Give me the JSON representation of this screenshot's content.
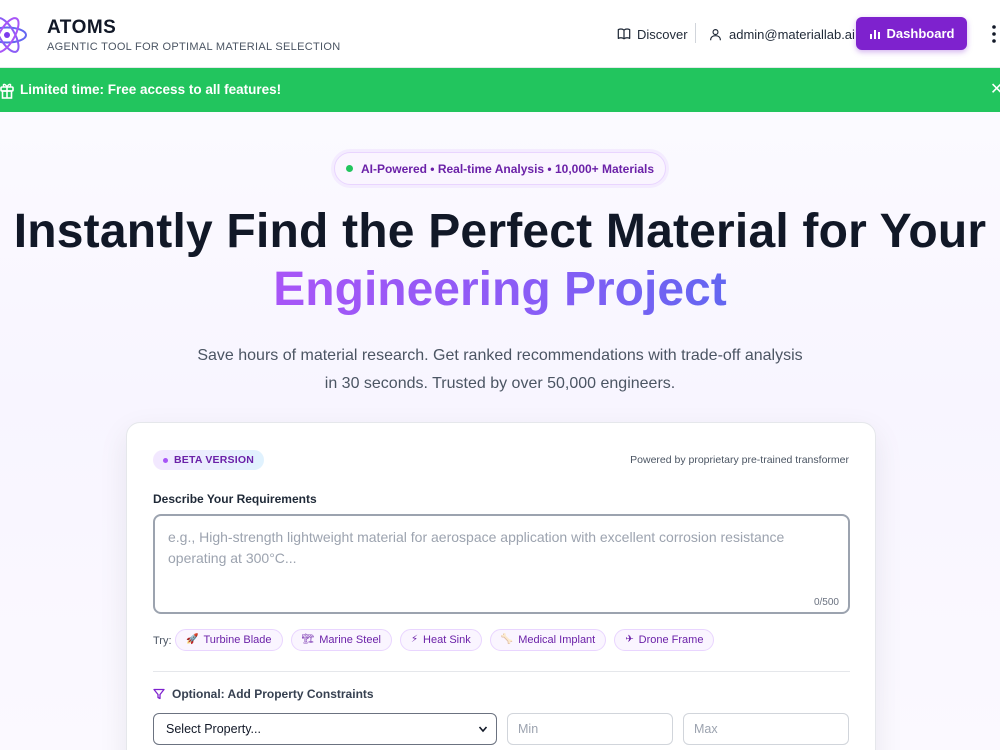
{
  "header": {
    "brand_name": "ATOMS",
    "brand_tagline": "AGENTIC TOOL FOR OPTIMAL MATERIAL SELECTION",
    "discover_label": "Discover",
    "user_email": "admin@materiallab.ai",
    "dashboard_label": "Dashboard"
  },
  "banner": {
    "text": "Limited time: Free access to all features!",
    "close_glyph": "✕"
  },
  "hero": {
    "pill_text": "AI-Powered • Real-time Analysis • 10,000+ Materials",
    "headline_line1": "Instantly Find the Perfect Material for Your",
    "headline_line2": "Engineering Project",
    "subheadline_line1": "Save hours of material research. Get ranked recommendations with trade-off analysis",
    "subheadline_line2": "in 30 seconds. Trusted by over 50,000 engineers."
  },
  "search_card": {
    "beta_label": "BETA VERSION",
    "powered_by": "Powered by proprietary pre-trained transformer",
    "requirements_label": "Describe Your Requirements",
    "requirements_placeholder": "e.g., High-strength lightweight material for aerospace application with excellent corrosion resistance operating at 300°C...",
    "char_count": "0/500",
    "try_label": "Try:",
    "examples": [
      {
        "label": "Turbine Blade",
        "icon": "🚀"
      },
      {
        "label": "Marine Steel",
        "icon": "🏗"
      },
      {
        "label": "Heat Sink",
        "icon": "⚡"
      },
      {
        "label": "Medical Implant",
        "icon": "🦴"
      },
      {
        "label": "Drone Frame",
        "icon": "✈"
      }
    ],
    "constraints_label": "Optional: Add Property Constraints",
    "property_select_value": "Select Property...",
    "min_placeholder": "Min",
    "max_placeholder": "Max"
  },
  "colors": {
    "brand_purple": "#7e22ce",
    "banner_green": "#22c55e",
    "gradient_start": "#a855f7",
    "gradient_end": "#6366f1"
  }
}
